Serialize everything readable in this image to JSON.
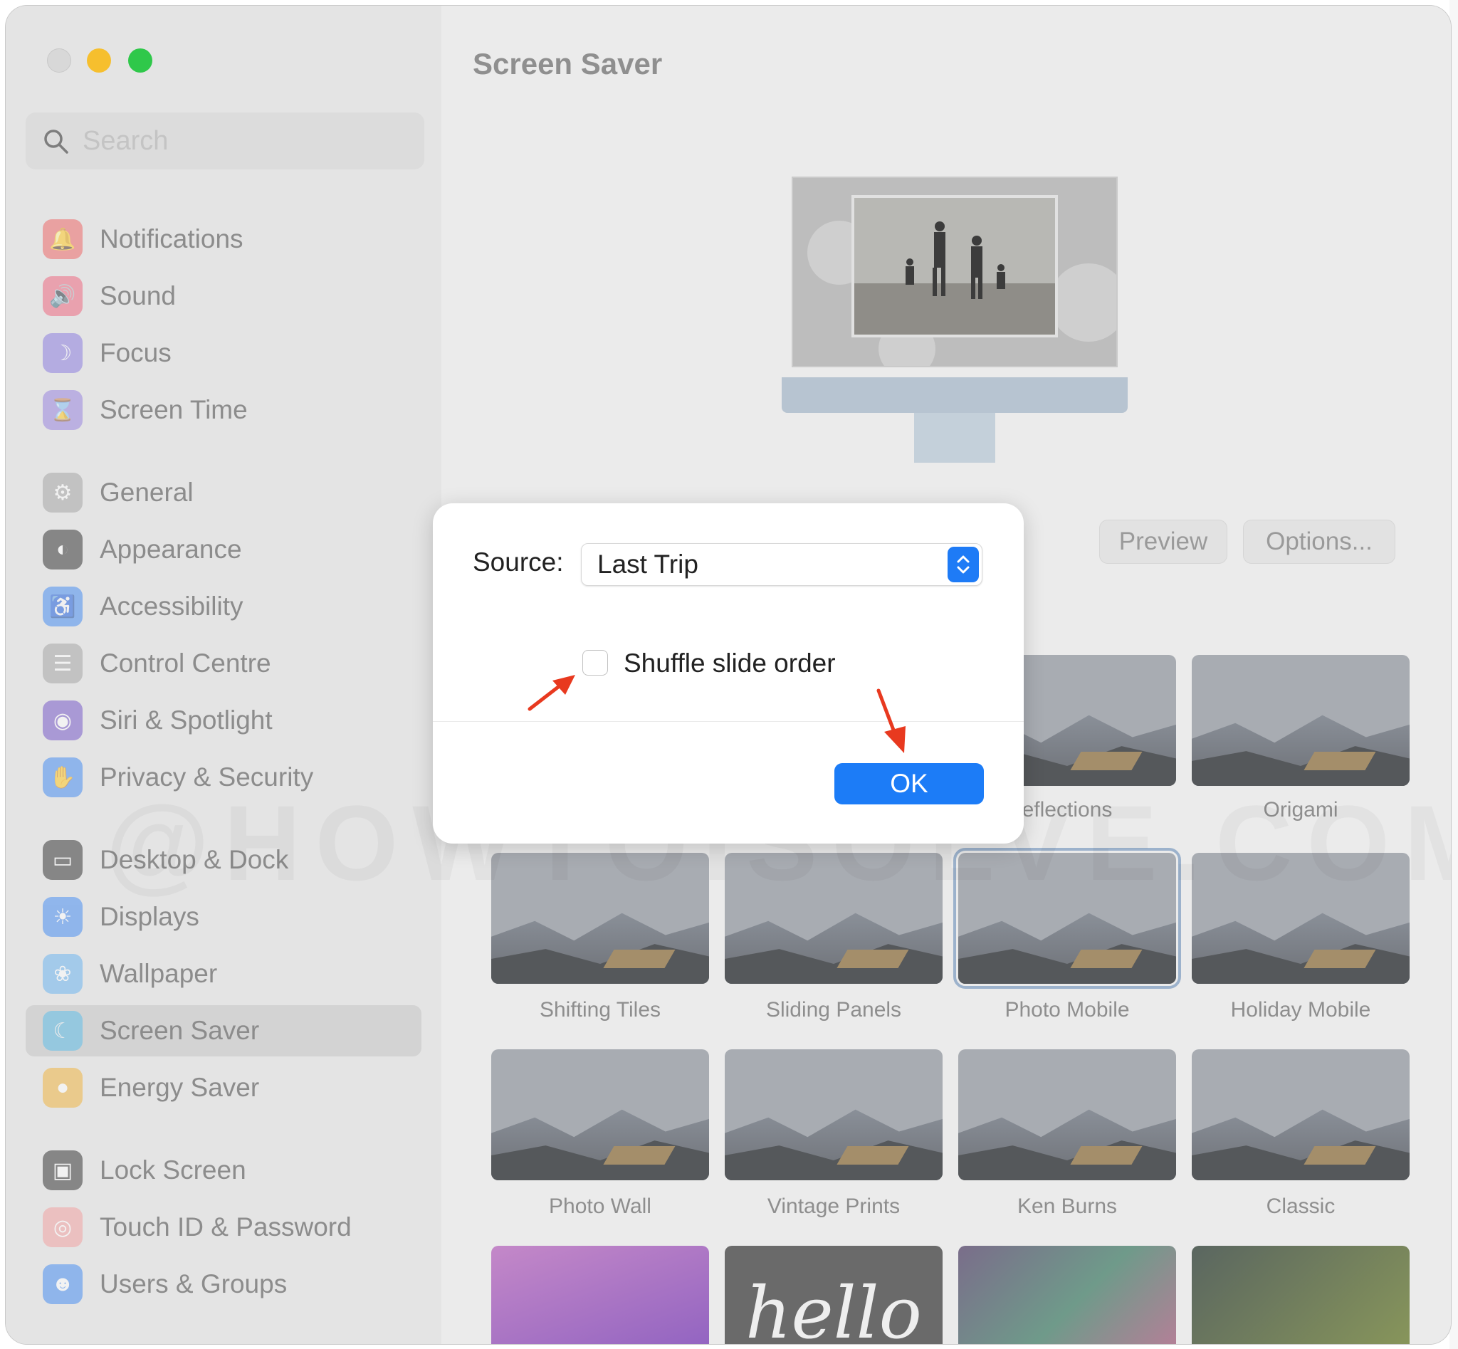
{
  "app": {
    "title": "Screen Saver"
  },
  "search": {
    "placeholder": "Search"
  },
  "sidebar": {
    "items": [
      {
        "label": "Notifications",
        "icon": "bell-icon",
        "color": "#ee6b6b"
      },
      {
        "label": "Sound",
        "icon": "speaker-icon",
        "color": "#ee6b82"
      },
      {
        "label": "Focus",
        "icon": "moon-icon",
        "color": "#8d7fe0"
      },
      {
        "label": "Screen Time",
        "icon": "hourglass-icon",
        "color": "#9a86e0"
      },
      {
        "label": "General",
        "icon": "gear-icon",
        "color": "#a7a7a7"
      },
      {
        "label": "Appearance",
        "icon": "appearance-icon",
        "color": "#3b3b3b"
      },
      {
        "label": "Accessibility",
        "icon": "accessibility-icon",
        "color": "#4b8ff2"
      },
      {
        "label": "Control Centre",
        "icon": "toggles-icon",
        "color": "#a7a7a7"
      },
      {
        "label": "Siri & Spotlight",
        "icon": "siri-icon",
        "color": "#7a5cc9"
      },
      {
        "label": "Privacy & Security",
        "icon": "hand-icon",
        "color": "#4b8ff2"
      },
      {
        "label": "Desktop & Dock",
        "icon": "dock-icon",
        "color": "#3b3b3b"
      },
      {
        "label": "Displays",
        "icon": "sun-icon",
        "color": "#4b8ff2"
      },
      {
        "label": "Wallpaper",
        "icon": "flower-icon",
        "color": "#6fb6f0"
      },
      {
        "label": "Screen Saver",
        "icon": "screensaver-icon",
        "color": "#63c0ea"
      },
      {
        "label": "Energy Saver",
        "icon": "bulb-icon",
        "color": "#f0b545"
      },
      {
        "label": "Lock Screen",
        "icon": "lock-screen-icon",
        "color": "#3b3b3b"
      },
      {
        "label": "Touch ID & Password",
        "icon": "fingerprint-icon",
        "color": "#f2a4a4"
      },
      {
        "label": "Users & Groups",
        "icon": "users-icon",
        "color": "#4b8ff2"
      }
    ],
    "selected": "Screen Saver"
  },
  "toolbar": {
    "preview_label": "Preview",
    "options_label": "Options..."
  },
  "savers": [
    {
      "label": "eflections"
    },
    {
      "label": "Origami"
    },
    {
      "label": "Shifting Tiles"
    },
    {
      "label": "Sliding Panels"
    },
    {
      "label": "Photo Mobile"
    },
    {
      "label": "Holiday Mobile"
    },
    {
      "label": "Photo Wall"
    },
    {
      "label": "Vintage Prints"
    },
    {
      "label": "Ken Burns"
    },
    {
      "label": "Classic"
    },
    {
      "label": ""
    },
    {
      "label": "hello"
    },
    {
      "label": ""
    },
    {
      "label": ""
    }
  ],
  "dialog": {
    "source_label": "Source:",
    "source_value": "Last Trip",
    "shuffle_label": "Shuffle slide order",
    "shuffle_checked": false,
    "ok_label": "OK"
  },
  "watermark": "@HOWTOISOLVE.COM",
  "colors": {
    "accent": "#1c7cf7",
    "annotation_arrow": "#e8391f"
  }
}
